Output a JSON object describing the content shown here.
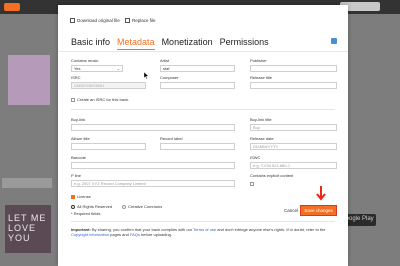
{
  "modal": {
    "download_label": "Download original file",
    "replace_label": "Replace file",
    "tabs": [
      "Basic info",
      "Metadata",
      "Monetization",
      "Permissions"
    ],
    "active_tab": "Metadata",
    "fields": {
      "contains_music": {
        "label": "Contains music",
        "value": "Yes"
      },
      "artist": {
        "label": "Artist",
        "value": "staf"
      },
      "publisher": {
        "label": "Publisher"
      },
      "isrc": {
        "label": "ISRC",
        "value": "DMBDXB008664"
      },
      "composer": {
        "label": "Composer"
      },
      "release_title": {
        "label": "Release title"
      },
      "create_isrc": "Create an ISRC for this track.",
      "buy_link": {
        "label": "Buy-link"
      },
      "buy_link_title": {
        "label": "Buy-link title",
        "value": "Buy"
      },
      "album_title": {
        "label": "Album title"
      },
      "record_label": {
        "label": "Record label"
      },
      "release_date": {
        "label": "Release date",
        "placeholder": "DD/MM/YYYY"
      },
      "barcode": {
        "label": "Barcode"
      },
      "iswc": {
        "label": "ISWC",
        "placeholder": "e.g. T-034.524.680-1"
      },
      "p_line": {
        "label": "P line",
        "placeholder": "e.g. 2007 XYZ Record Company Limited"
      },
      "explicit": {
        "label": "Contains explicit content"
      },
      "license": {
        "label": "License"
      },
      "all_rights": "All Rights Reserved",
      "creative_commons": "Creative Commons"
    },
    "required_note": "* Required fields",
    "cancel_label": "Cancel",
    "save_label": "Save changes",
    "fine_print": {
      "important": "Important:",
      "text1": " By sharing, you confirm that your track complies with our ",
      "terms": "Terms of use",
      "text2": " and don't infringe anyone else's rights. If in doubt, refer to the ",
      "copyright": "Copyright information",
      "text3": " pages and ",
      "faqs": "FAQs",
      "text4": " before uploading."
    }
  },
  "background": {
    "art_text": "LET ME LOVE YOU",
    "badge": "Google Play"
  },
  "colors": {
    "accent": "#f26f23",
    "arrow": "#e8271a"
  }
}
